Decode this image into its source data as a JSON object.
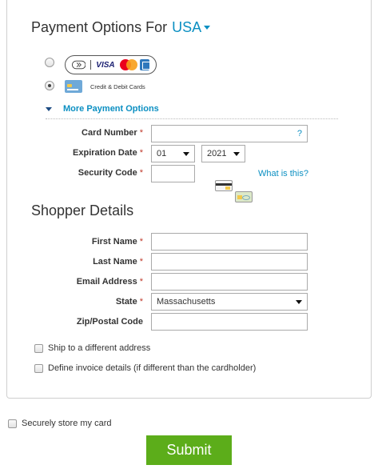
{
  "payment_header": {
    "title": "Payment Options For",
    "country": "USA"
  },
  "payment_methods": {
    "option1": {
      "brand_text": "VISA"
    },
    "option2": {
      "label": "Credit & Debit Cards"
    },
    "more_label": "More Payment Options"
  },
  "card_form": {
    "card_number": {
      "label": "Card Number",
      "required_mark": "*",
      "value": "",
      "help": "?"
    },
    "expiration": {
      "label": "Expiration Date",
      "required_mark": "*",
      "month": "01",
      "year": "2021"
    },
    "security_code": {
      "label": "Security Code",
      "required_mark": "*",
      "value": "",
      "what_link": "What is this?"
    }
  },
  "shopper": {
    "title": "Shopper Details",
    "first_name": {
      "label": "First Name",
      "required_mark": "*",
      "value": ""
    },
    "last_name": {
      "label": "Last Name",
      "required_mark": "*",
      "value": ""
    },
    "email": {
      "label": "Email Address",
      "required_mark": "*",
      "value": ""
    },
    "state": {
      "label": "State",
      "required_mark": "*",
      "value": "Massachusetts"
    },
    "zip": {
      "label": "Zip/Postal Code",
      "value": ""
    }
  },
  "options": {
    "ship_different": "Ship to a different address",
    "invoice_details": "Define invoice details (if different than the cardholder)"
  },
  "store_card": "Securely store my card",
  "submit_label": "Submit",
  "colors": {
    "accent": "#0b8fc2",
    "submit": "#5cad1a",
    "required": "#c0392b"
  }
}
